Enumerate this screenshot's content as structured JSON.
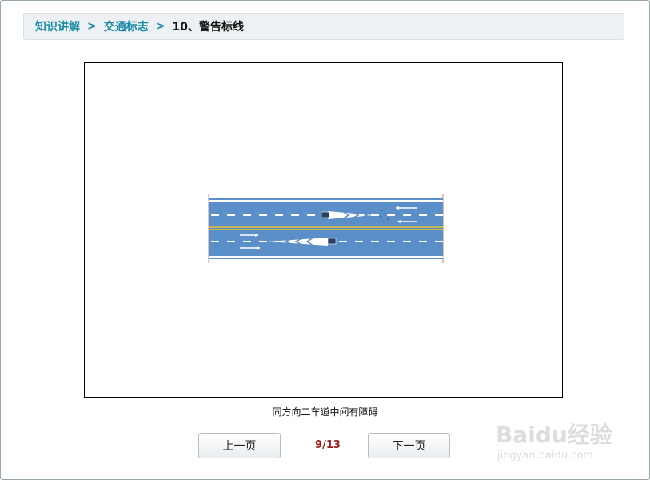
{
  "breadcrumb": {
    "items": [
      {
        "label": "知识讲解"
      },
      {
        "label": "交通标志"
      }
    ],
    "current": "10、警告标线",
    "separator": ">"
  },
  "figure": {
    "caption": "同方向二车道中间有障碍"
  },
  "pagination": {
    "prev_label": "上一页",
    "next_label": "下一页",
    "indicator": "9/13"
  },
  "watermark": {
    "brand": "Baidu经验",
    "url": "jingyan.baidu.com"
  },
  "colors": {
    "link": "#1a8aa6",
    "indicator": "#9b1b1b",
    "road": "#5b8fc9",
    "center_line": "#e6c030"
  }
}
